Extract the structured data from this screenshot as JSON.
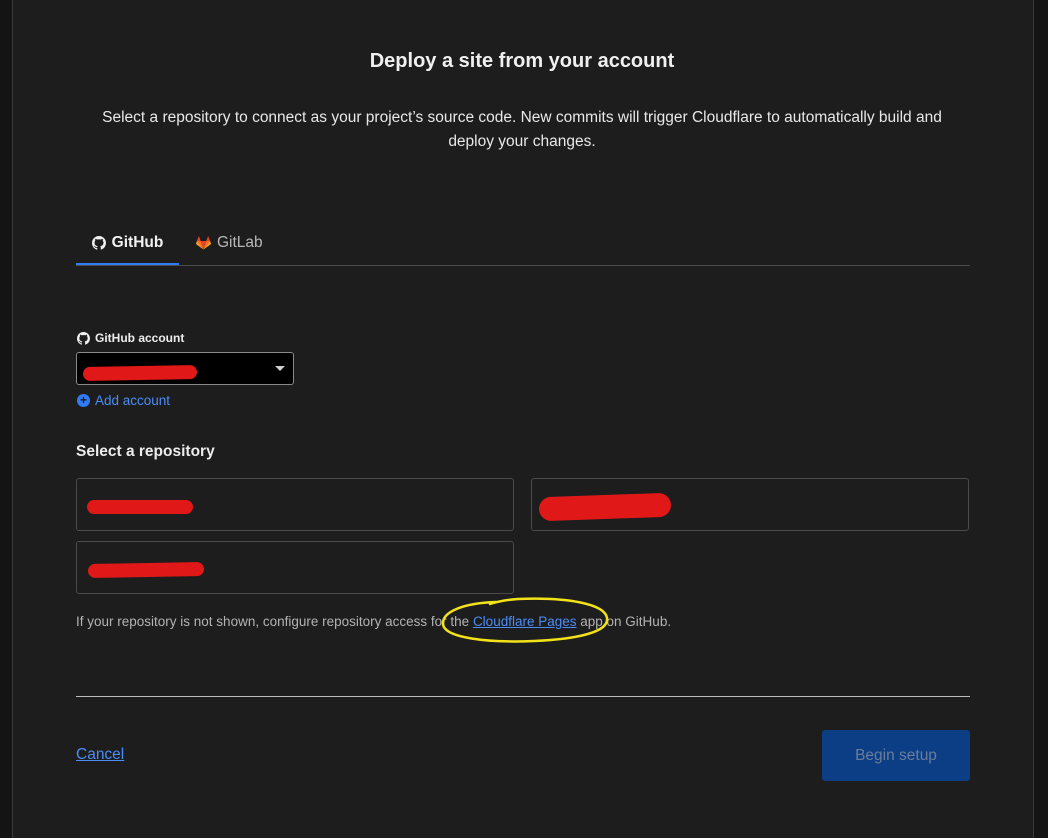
{
  "title": "Deploy a site from your account",
  "description": "Select a repository to connect as your project’s source code. New commits will trigger Cloudflare to automatically build and deploy your changes.",
  "tabs": [
    {
      "label": "GitHub",
      "icon": "github-icon",
      "active": true
    },
    {
      "label": "GitLab",
      "icon": "gitlab-icon",
      "active": false
    }
  ],
  "account": {
    "label": "GitHub account",
    "icon": "github-icon",
    "selected_value": "",
    "add_label": "Add account"
  },
  "repositories": {
    "heading": "Select a repository",
    "items": [
      "",
      "",
      ""
    ]
  },
  "hint": {
    "before": "If your repository is not shown, configure repository access for the ",
    "link": "Cloudflare Pages",
    "after": " app on GitHub."
  },
  "footer": {
    "cancel_label": "Cancel",
    "begin_label": "Begin setup"
  },
  "colors": {
    "accent": "#2f7cf6",
    "redaction": "#e01818",
    "annotation": "#f2e21a",
    "primary_disabled": "#0c3e86"
  }
}
